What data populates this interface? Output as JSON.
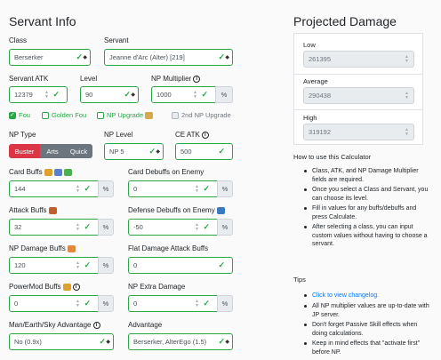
{
  "left": {
    "title": "Servant Info",
    "class": {
      "label": "Class",
      "value": "Berserker"
    },
    "servant": {
      "label": "Servant",
      "value": "Jeanne d'Arc (Alter) [219]"
    },
    "atk": {
      "label": "Servant ATK",
      "value": "12379"
    },
    "level": {
      "label": "Level",
      "value": "90"
    },
    "np_mult": {
      "label": "NP Multiplier",
      "value": "1000",
      "unit": "%"
    },
    "fou": "Fou",
    "golden_fou": "Golden Fou",
    "np_upgrade": "NP Upgrade",
    "second_np_upgrade": "2nd NP Upgrade",
    "np_type": {
      "label": "NP Type",
      "buster": "Buster",
      "arts": "Arts",
      "quick": "Quick"
    },
    "np_level": {
      "label": "NP Level",
      "value": "NP 5"
    },
    "ce_atk": {
      "label": "CE ATK",
      "value": "500"
    },
    "card_buffs": {
      "label": "Card Buffs",
      "value": "144",
      "unit": "%"
    },
    "card_debuffs": {
      "label": "Card Debuffs on Enemy",
      "value": "0",
      "unit": "%"
    },
    "attack_buffs": {
      "label": "Attack Buffs",
      "value": "32",
      "unit": "%"
    },
    "defense_debuffs": {
      "label": "Defense Debuffs on Enemy",
      "value": "-50",
      "unit": "%"
    },
    "np_damage_buffs": {
      "label": "NP Damage Buffs",
      "value": "120",
      "unit": "%"
    },
    "flat_damage": {
      "label": "Flat Damage Attack Buffs",
      "value": "0"
    },
    "powermod": {
      "label": "PowerMod Buffs",
      "value": "0",
      "unit": "%"
    },
    "np_extra": {
      "label": "NP Extra Damage",
      "value": "0",
      "unit": "%"
    },
    "man_earth_sky": {
      "label": "Man/Earth/Sky Advantage",
      "value": "No (0.9x)"
    },
    "advantage": {
      "label": "Advantage",
      "value": "Berserker, AlterEgo (1.5)"
    }
  },
  "right": {
    "title": "Projected Damage",
    "low": {
      "label": "Low",
      "value": "261395"
    },
    "average": {
      "label": "Average",
      "value": "290438"
    },
    "high": {
      "label": "High",
      "value": "319192"
    },
    "how_title": "How to use this Calculator",
    "how_items": [
      "Class, ATK, and NP Damage Multiplier fields are required.",
      "Once you select a Class and Servant, you can choose its level.",
      "Fill in values for any buffs/debuffs and press Calculate.",
      "After selecting a class, you can input custom values without having to choose a servant."
    ],
    "tips_title": "Tips",
    "tips_link": "Click to view changelog.",
    "tips_items": [
      "All NP multiplier values are up-to-date with JP server.",
      "Don't forget Passive Skill effects when doing calculations.",
      "Keep in mind effects that \"activate first\" before NP."
    ]
  },
  "colors": {
    "green": "#28a745",
    "buster": "#dc3545",
    "arts": "#6c757d",
    "quick": "#6c757d",
    "link": "#007bff"
  }
}
